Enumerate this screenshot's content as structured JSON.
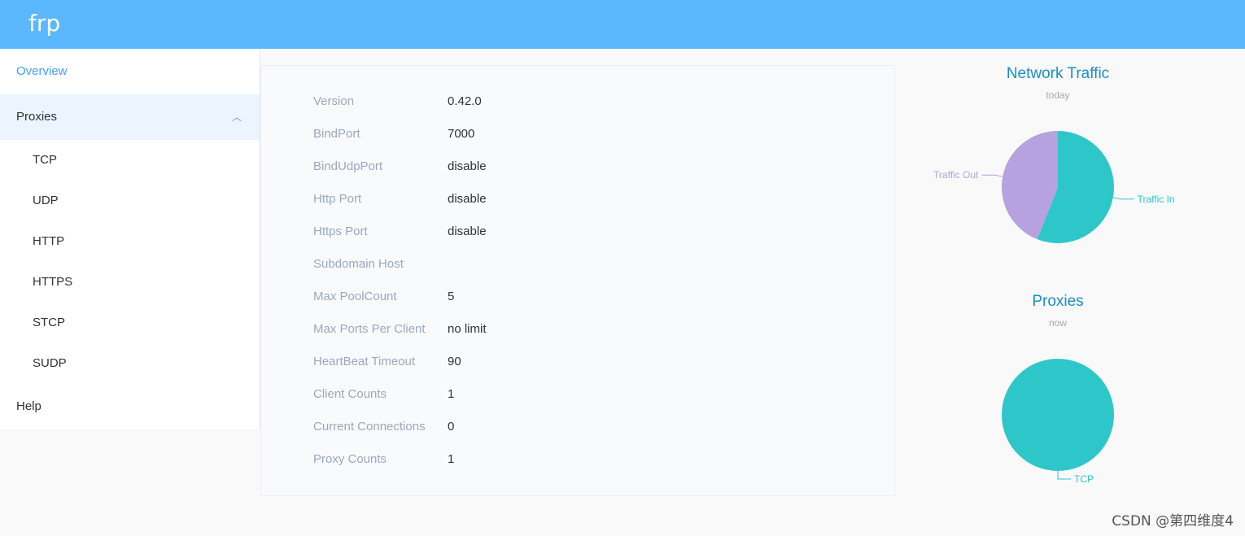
{
  "header": {
    "brand": "frp"
  },
  "sidebar": {
    "overview": "Overview",
    "proxies": "Proxies",
    "proxy_types": [
      "TCP",
      "UDP",
      "HTTP",
      "HTTPS",
      "STCP",
      "SUDP"
    ],
    "help": "Help",
    "icons": {
      "proxies_toggle": "chevron-up-icon"
    }
  },
  "server_info": [
    {
      "key": "Version",
      "value": "0.42.0"
    },
    {
      "key": "BindPort",
      "value": "7000"
    },
    {
      "key": "BindUdpPort",
      "value": "disable"
    },
    {
      "key": "Http Port",
      "value": "disable"
    },
    {
      "key": "Https Port",
      "value": "disable"
    },
    {
      "key": "Subdomain Host",
      "value": ""
    },
    {
      "key": "Max PoolCount",
      "value": "5"
    },
    {
      "key": "Max Ports Per Client",
      "value": "no limit"
    },
    {
      "key": "HeartBeat Timeout",
      "value": "90"
    },
    {
      "key": "Client Counts",
      "value": "1"
    },
    {
      "key": "Current Connections",
      "value": "0"
    },
    {
      "key": "Proxy Counts",
      "value": "1"
    }
  ],
  "chart_data": [
    {
      "type": "pie",
      "title": "Network Traffic",
      "subtitle": "today",
      "series": [
        {
          "name": "Traffic In",
          "value": 56,
          "color": "#2ec7c9"
        },
        {
          "name": "Traffic Out",
          "value": 44,
          "color": "#b6a2de"
        }
      ]
    },
    {
      "type": "pie",
      "title": "Proxies",
      "subtitle": "now",
      "series": [
        {
          "name": "TCP",
          "value": 1,
          "color": "#2ec7c9"
        }
      ]
    }
  ],
  "watermark": "CSDN @第四维度4",
  "colors": {
    "header": "#5bb8ff",
    "active": "#409eff",
    "chart_title": "#1a8fc8"
  }
}
